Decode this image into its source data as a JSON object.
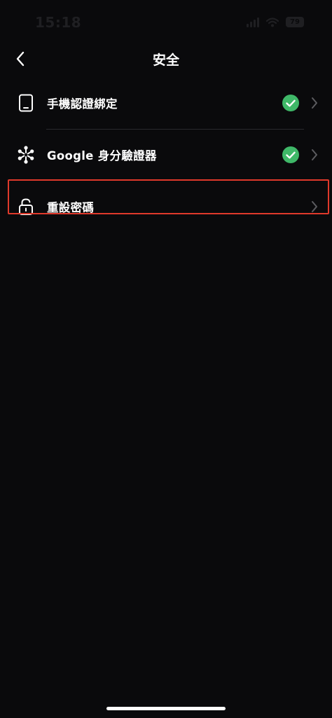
{
  "status_bar": {
    "time": "15:18",
    "battery": "79"
  },
  "header": {
    "title": "安全"
  },
  "items": [
    {
      "label": "手機認證綁定",
      "icon": "phone-icon",
      "verified": true
    },
    {
      "label": "Google 身分驗證器",
      "icon": "google-authenticator-icon",
      "verified": true
    },
    {
      "label": "重設密碼",
      "icon": "unlock-icon",
      "verified": false,
      "highlighted": true
    }
  ],
  "colors": {
    "background": "#0a0a0c",
    "check": "#3fb868",
    "highlight": "#e0392b",
    "chevron": "#5c5c60"
  }
}
